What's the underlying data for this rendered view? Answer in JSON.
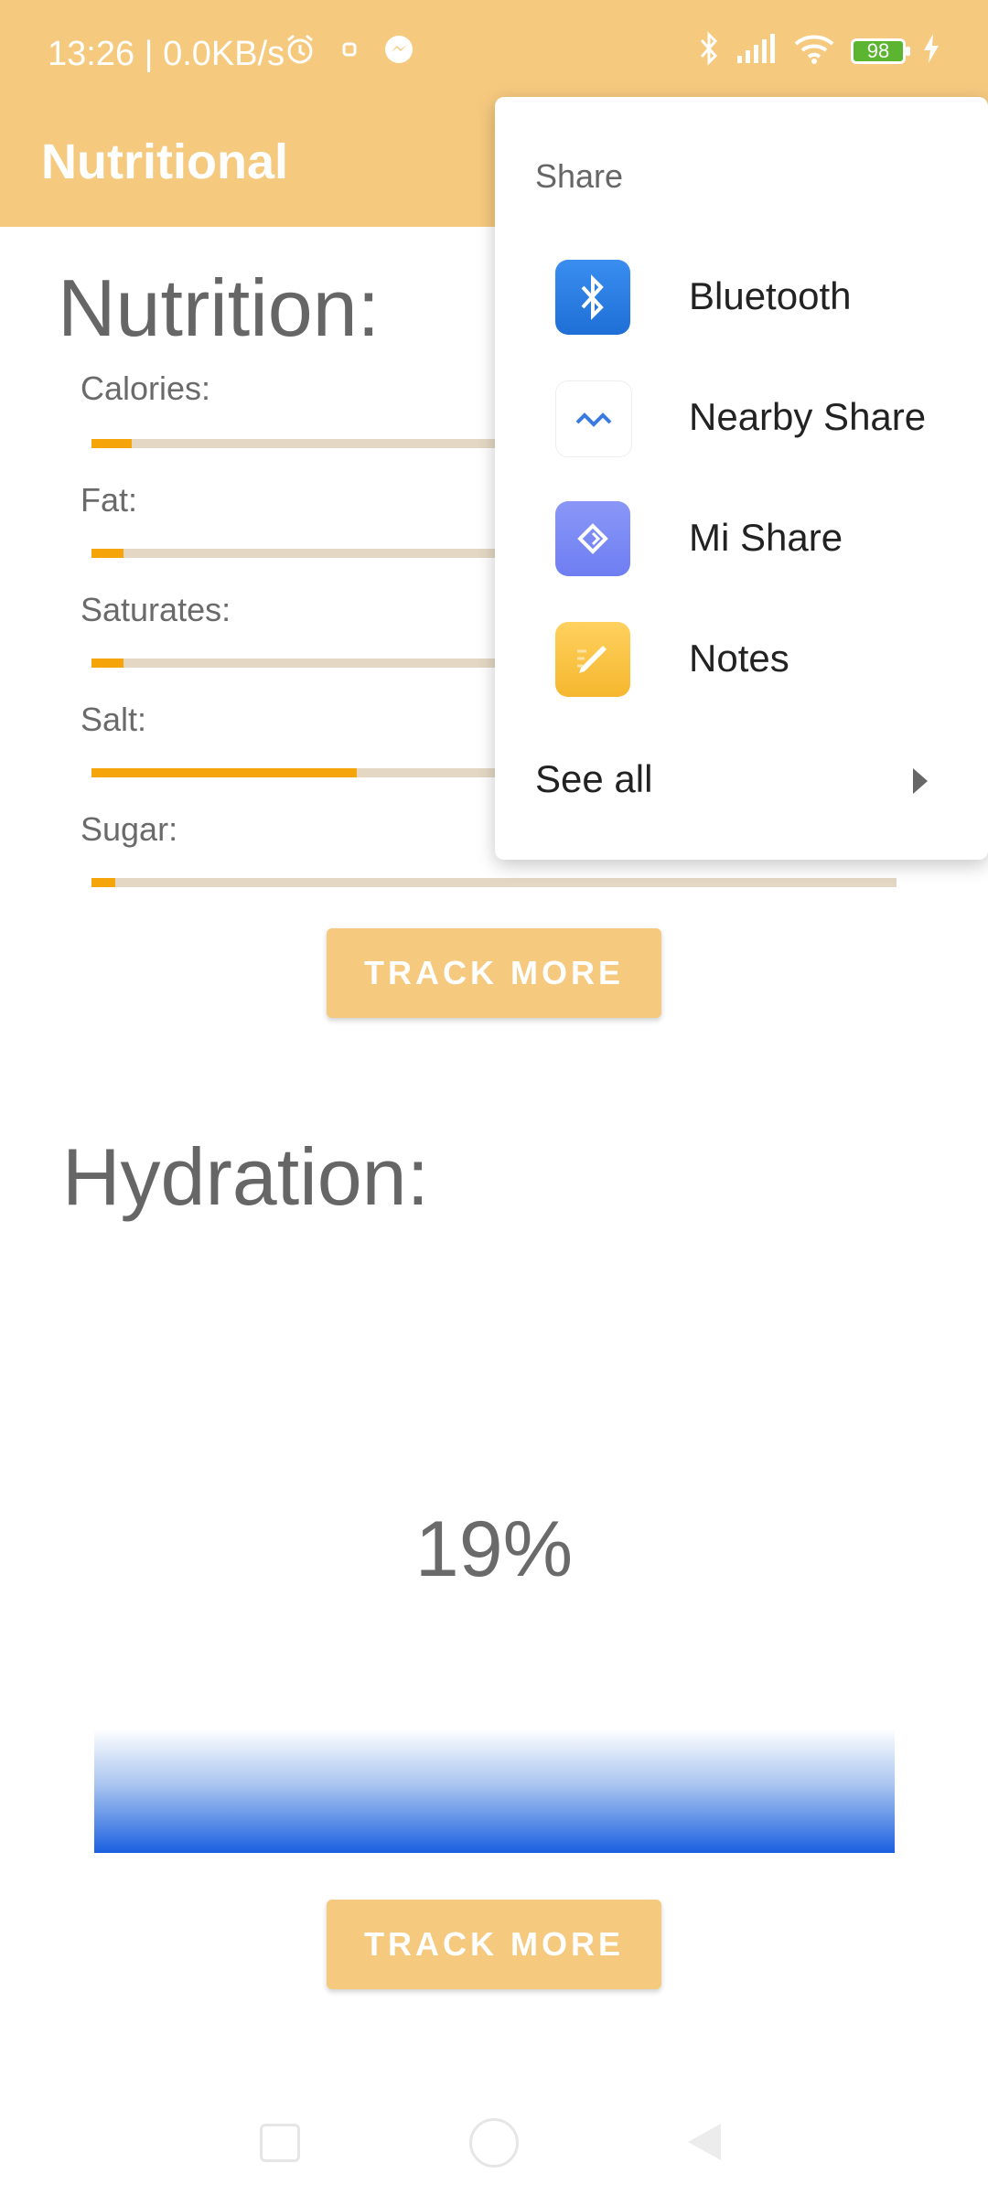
{
  "status_bar": {
    "time_text": "13:26 | 0.0KB/s",
    "battery": "98",
    "icons": [
      "alarm-icon",
      "notification-icon",
      "messenger-icon",
      "bluetooth-icon",
      "signal-icon",
      "wifi-icon",
      "battery-icon",
      "charging-icon"
    ]
  },
  "appbar": {
    "title": "Nutritional"
  },
  "nutrition": {
    "title": "Nutrition:",
    "items": [
      {
        "label": "Calories:",
        "level": 0.05
      },
      {
        "label": "Fat:",
        "level": 0.04
      },
      {
        "label": "Saturates:",
        "level": 0.04
      },
      {
        "label": "Salt:",
        "level": 0.33
      },
      {
        "label": "Sugar:",
        "level": 0.03
      }
    ],
    "track_more": "TRACK MORE"
  },
  "hydration": {
    "title": "Hydration:",
    "percent_text": "19%",
    "level": 0.19,
    "track_more": "TRACK MORE"
  },
  "share_menu": {
    "header": "Share",
    "items": [
      {
        "label": "Bluetooth",
        "icon": "bluetooth-icon",
        "color": "#2f7fe0"
      },
      {
        "label": "Nearby Share",
        "icon": "nearby-share-icon",
        "color": "#ffffff"
      },
      {
        "label": "Mi Share",
        "icon": "mi-share-icon",
        "color": "#7f8cf5"
      },
      {
        "label": "Notes",
        "icon": "notes-icon",
        "color": "#f9c246"
      }
    ],
    "see_all": "See all"
  },
  "colors": {
    "accent": "#f5c97e",
    "bar_fill": "#f5a50a",
    "bar_track": "#e4d8c4",
    "hydration_fill": "#1a5fe0"
  }
}
